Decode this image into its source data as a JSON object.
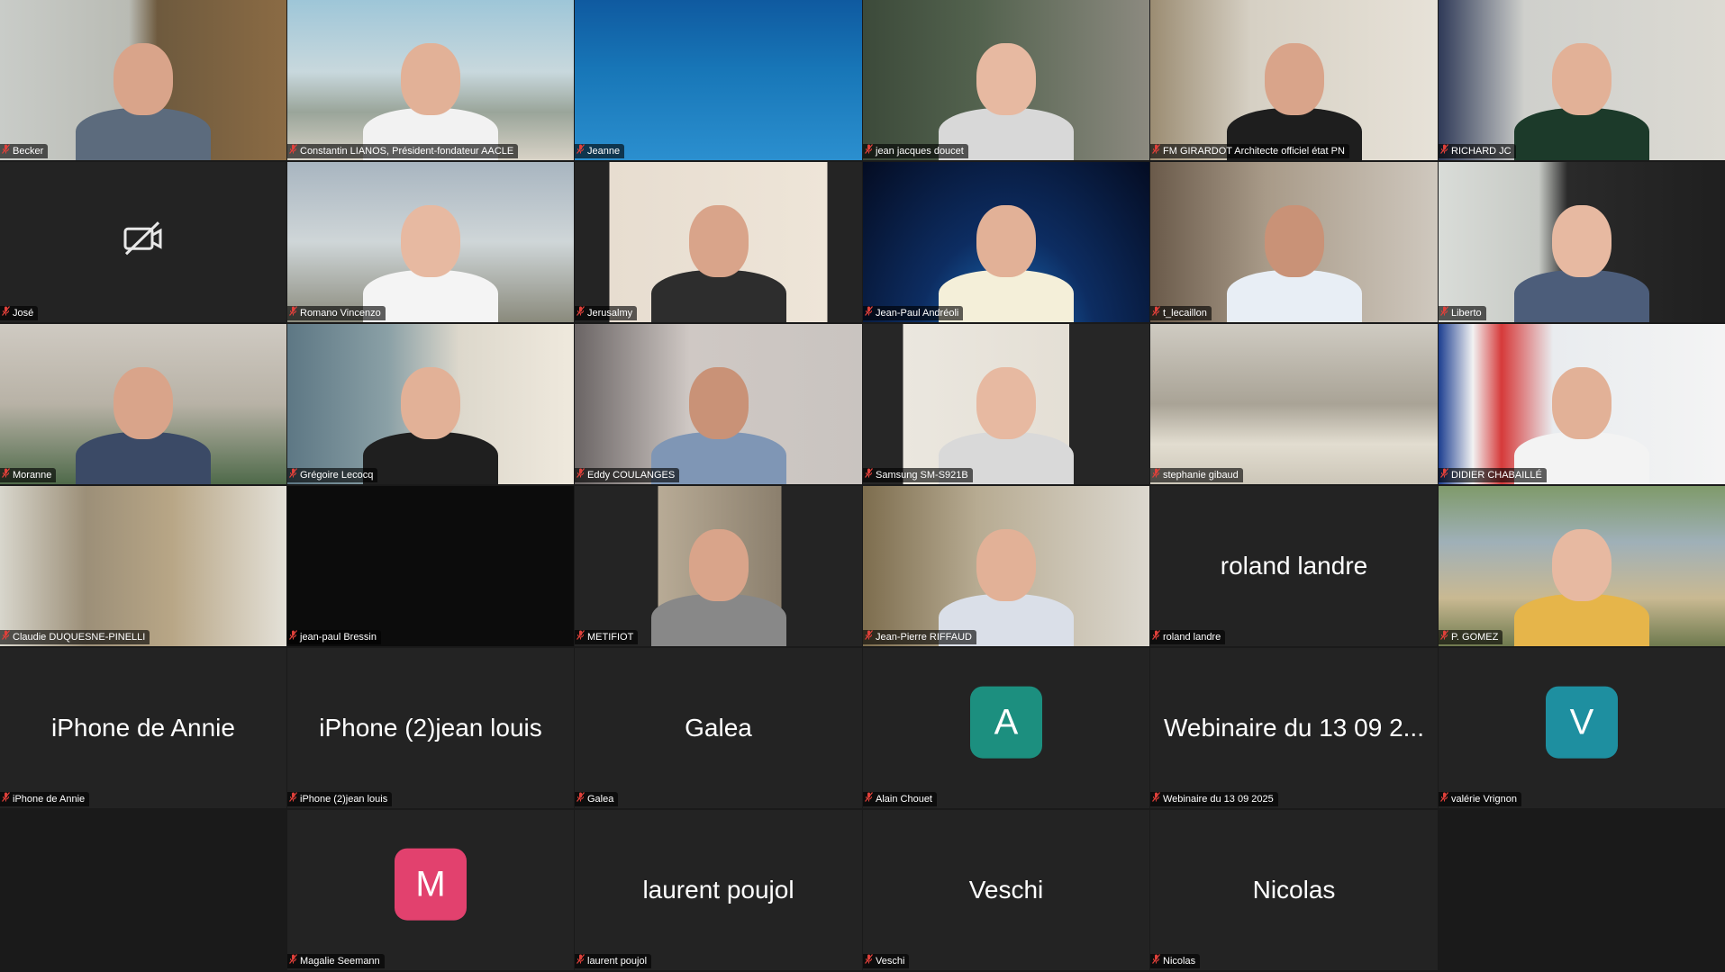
{
  "tiles": [
    {
      "name": "Becker",
      "kind": "video"
    },
    {
      "name": "Constantin LIANOS, Président-fondateur AACLE",
      "kind": "video"
    },
    {
      "name": "Jeanne",
      "kind": "video"
    },
    {
      "name": "jean jacques doucet",
      "kind": "video"
    },
    {
      "name": "FM GIRARDOT Architecte officiel état PN",
      "kind": "video"
    },
    {
      "name": "RICHARD JC",
      "kind": "video"
    },
    {
      "name": "José",
      "kind": "camera-off"
    },
    {
      "name": "Romano Vincenzo",
      "kind": "video"
    },
    {
      "name": "Jerusalmy",
      "kind": "video",
      "active": true
    },
    {
      "name": "Jean-Paul Andréoli",
      "kind": "video"
    },
    {
      "name": "t_lecaillon",
      "kind": "video"
    },
    {
      "name": "Liberto",
      "kind": "video"
    },
    {
      "name": "Moranne",
      "kind": "video"
    },
    {
      "name": "Grégoire Lecocq",
      "kind": "video"
    },
    {
      "name": "Eddy COULANGES",
      "kind": "video"
    },
    {
      "name": "Samsung SM-S921B",
      "kind": "video"
    },
    {
      "name": "stephanie gibaud",
      "kind": "video"
    },
    {
      "name": "DIDIER CHABAILLÉ",
      "kind": "video"
    },
    {
      "name": "Claudie DUQUESNE-PINELLI",
      "kind": "video"
    },
    {
      "name": "jean-paul Bressin",
      "kind": "video"
    },
    {
      "name": "METIFIOT",
      "kind": "video"
    },
    {
      "name": "Jean-Pierre RIFFAUD",
      "kind": "video"
    },
    {
      "name": "roland landre",
      "kind": "name",
      "display": "roland landre"
    },
    {
      "name": "P. GOMEZ",
      "kind": "video"
    },
    {
      "name": "iPhone de Annie",
      "kind": "name",
      "display": "iPhone de Annie"
    },
    {
      "name": "iPhone (2)jean louis",
      "kind": "name",
      "display": "iPhone (2)jean louis"
    },
    {
      "name": "Galea",
      "kind": "name",
      "display": "Galea"
    },
    {
      "name": "Alain Chouet",
      "kind": "avatar",
      "initial": "A",
      "color": "#1c8f7f"
    },
    {
      "name": "Webinaire du 13 09 2025",
      "kind": "name",
      "display": "Webinaire du 13 09 2..."
    },
    {
      "name": "valérie Vrignon",
      "kind": "avatar",
      "initial": "V",
      "color": "#1e8fa0"
    },
    {
      "name": "Magalie Seemann",
      "kind": "avatar",
      "initial": "M",
      "color": "#e2416e"
    },
    {
      "name": "laurent poujol",
      "kind": "name",
      "display": "laurent poujol"
    },
    {
      "name": "Veschi",
      "kind": "name",
      "display": "Veschi"
    },
    {
      "name": "Nicolas",
      "kind": "name",
      "display": "Nicolas"
    }
  ],
  "colors": {
    "background": "#1a1a1a",
    "tile": "#232323",
    "active_speaker": "#2dbf4e",
    "muted_icon": "#e0403a"
  },
  "icons": {
    "muted": "mic-muted-icon",
    "camera_off": "video-off-icon"
  }
}
